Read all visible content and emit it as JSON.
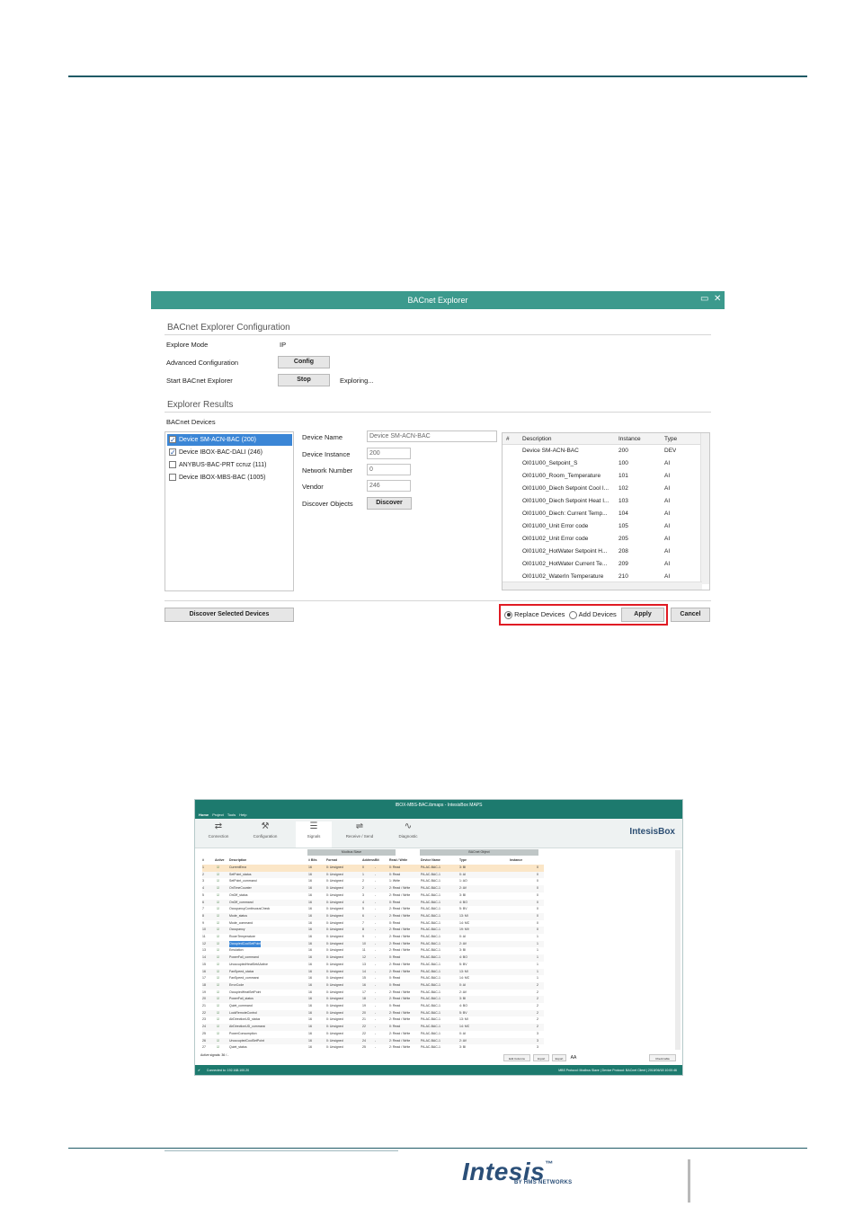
{
  "explorer": {
    "title": "BACnet Explorer",
    "config_title": "BACnet Explorer Configuration",
    "explore_mode_label": "Explore Mode",
    "explore_mode_value": "IP",
    "advanced_label": "Advanced Configuration",
    "config_btn": "Config",
    "start_label": "Start BACnet Explorer",
    "stop_btn": "Stop",
    "status": "Exploring...",
    "results_title": "Explorer Results",
    "devices_label": "BACnet Devices",
    "devices": [
      {
        "label": "Device SM-ACN-BAC (200)",
        "checked": true,
        "selected": true
      },
      {
        "label": "Device IBOX-BAC-DALI (246)",
        "checked": true,
        "selected": false
      },
      {
        "label": "ANYBUS-BAC-PRT ccruz (111)",
        "checked": false,
        "selected": false
      },
      {
        "label": "Device IBOX-MBS-BAC (1005)",
        "checked": false,
        "selected": false
      }
    ],
    "device_name_label": "Device Name",
    "device_name_value": "Device SM-ACN-BAC",
    "device_instance_label": "Device Instance",
    "device_instance_value": "200",
    "network_number_label": "Network Number",
    "network_number_value": "0",
    "vendor_label": "Vendor",
    "vendor_value": "246",
    "discover_objects_label": "Discover Objects",
    "discover_btn": "Discover",
    "objects_headers": {
      "num": "#",
      "description": "Description",
      "instance": "Instance",
      "type": "Type"
    },
    "objects": [
      {
        "checked": false,
        "description": "Device SM-ACN-BAC",
        "instance": "200",
        "type": "DEV"
      },
      {
        "checked": true,
        "description": "OI01U00_Setpoint_S",
        "instance": "100",
        "type": "AI"
      },
      {
        "checked": true,
        "description": "OI01U00_Room_Temperature",
        "instance": "101",
        "type": "AI"
      },
      {
        "checked": false,
        "description": "OI01U00_Diech Setpoint Cool I...",
        "instance": "102",
        "type": "AI"
      },
      {
        "checked": false,
        "description": "OI01U00_Diech Setpoint Heat I...",
        "instance": "103",
        "type": "AI"
      },
      {
        "checked": false,
        "description": "OI01U00_Diech: Current Temp...",
        "instance": "104",
        "type": "AI"
      },
      {
        "checked": true,
        "description": "OI01U00_Unit Error code",
        "instance": "105",
        "type": "AI"
      },
      {
        "checked": false,
        "description": "OI01U02_Unit Error code",
        "instance": "205",
        "type": "AI"
      },
      {
        "checked": false,
        "description": "OI01U02_HotWater Setpoint H...",
        "instance": "208",
        "type": "AI"
      },
      {
        "checked": false,
        "description": "OI01U02_HotWater Current Te...",
        "instance": "209",
        "type": "AI"
      },
      {
        "checked": false,
        "description": "OI01U02_WaterIn Temperature",
        "instance": "210",
        "type": "AI"
      }
    ],
    "discover_selected_btn": "Discover Selected Devices",
    "replace_label": "Replace Devices",
    "add_label": "Add Devices",
    "apply_btn": "Apply",
    "cancel_btn": "Cancel"
  },
  "maps": {
    "title": "IBOX-MBS-BAC.ibmaps - IntesisBox MAPS",
    "menu": [
      "Home",
      "Project",
      "Tools",
      "Help"
    ],
    "tabs": [
      "Connection",
      "Configuration",
      "Signals",
      "Receive / Send",
      "Diagnostic"
    ],
    "brand": "IntesisBox",
    "group_modbus": "Modbus Slave",
    "group_bacnet": "BACnet Object",
    "headers": [
      "#",
      "Active",
      "Description",
      "# Bits",
      "Format",
      "Address",
      "Bit",
      "Read / Write",
      "Device Name",
      "Type",
      "Instance"
    ],
    "rows": [
      [
        "1",
        "CurrentError",
        "16",
        "0: Unsigned",
        "0",
        "-",
        "0: Read",
        "PA-AC-BAC-1",
        "3: BI",
        "0"
      ],
      [
        "2",
        "SetPoint_status",
        "16",
        "0: Unsigned",
        "1",
        "-",
        "0: Read",
        "PA-AC-BAC-1",
        "0: AI",
        "0"
      ],
      [
        "3",
        "SetPoint_command",
        "16",
        "0: Unsigned",
        "2",
        "-",
        "1: Write",
        "PA-AC-BAC-1",
        "1: AO",
        "0"
      ],
      [
        "4",
        "OnTimeCounter",
        "16",
        "0: Unsigned",
        "2",
        "-",
        "2: Read / Write",
        "PA-AC-BAC-1",
        "2: AV",
        "0"
      ],
      [
        "5",
        "OnOff_status",
        "16",
        "0: Unsigned",
        "3",
        "-",
        "2: Read / Write",
        "PA-AC-BAC-1",
        "3: BI",
        "0"
      ],
      [
        "6",
        "OnOff_command",
        "16",
        "0: Unsigned",
        "4",
        "-",
        "0: Read",
        "PA-AC-BAC-1",
        "4: BO",
        "0"
      ],
      [
        "7",
        "OccupancyContinuousCheck",
        "16",
        "0: Unsigned",
        "5",
        "-",
        "2: Read / Write",
        "PA-AC-BAC-1",
        "5: BV",
        "0"
      ],
      [
        "8",
        "Mode_status",
        "16",
        "0: Unsigned",
        "6",
        "-",
        "2: Read / Write",
        "PA-AC-BAC-1",
        "13: MI",
        "0"
      ],
      [
        "9",
        "Mode_command",
        "16",
        "0: Unsigned",
        "7",
        "-",
        "0: Read",
        "PA-AC-BAC-1",
        "14: MO",
        "0"
      ],
      [
        "10",
        "Occupancy",
        "16",
        "0: Unsigned",
        "8",
        "-",
        "2: Read / Write",
        "PA-AC-BAC-1",
        "19: MV",
        "0"
      ],
      [
        "11",
        "RoomTemperature",
        "16",
        "0: Unsigned",
        "9",
        "-",
        "2: Read / Write",
        "PA-AC-BAC-1",
        "0: AI",
        "1"
      ],
      [
        "12",
        "OccupiedCoolSetPoint",
        "16",
        "0: Unsigned",
        "10",
        "-",
        "2: Read / Write",
        "PA-AC-BAC-1",
        "2: AV",
        "1"
      ],
      [
        "13",
        "Emulation",
        "16",
        "0: Unsigned",
        "11",
        "-",
        "2: Read / Write",
        "PA-AC-BAC-1",
        "3: BI",
        "1"
      ],
      [
        "14",
        "PowerFail_command",
        "16",
        "0: Unsigned",
        "12",
        "-",
        "0: Read",
        "PA-AC-BAC-1",
        "4: BO",
        "1"
      ],
      [
        "15",
        "UnoccupiedHeatSetAActive",
        "16",
        "0: Unsigned",
        "13",
        "-",
        "2: Read / Write",
        "PA-AC-BAC-1",
        "5: BV",
        "1"
      ],
      [
        "16",
        "FanSpeed_status",
        "16",
        "0: Unsigned",
        "14",
        "-",
        "2: Read / Write",
        "PA-AC-BAC-1",
        "13: MI",
        "1"
      ],
      [
        "17",
        "FanSpeed_command",
        "16",
        "0: Unsigned",
        "15",
        "-",
        "0: Read",
        "PA-AC-BAC-1",
        "14: MO",
        "1"
      ],
      [
        "18",
        "ErrorCode",
        "16",
        "0: Unsigned",
        "16",
        "-",
        "0: Read",
        "PA-AC-BAC-1",
        "0: AI",
        "2"
      ],
      [
        "19",
        "OccupiedHeatSetPoint",
        "16",
        "0: Unsigned",
        "17",
        "-",
        "2: Read / Write",
        "PA-AC-BAC-1",
        "2: AV",
        "2"
      ],
      [
        "20",
        "PowerFail_status",
        "16",
        "0: Unsigned",
        "18",
        "-",
        "2: Read / Write",
        "PA-AC-BAC-1",
        "3: BI",
        "2"
      ],
      [
        "21",
        "Quiet_command",
        "16",
        "0: Unsigned",
        "19",
        "-",
        "0: Read",
        "PA-AC-BAC-1",
        "4: BO",
        "2"
      ],
      [
        "22",
        "LockRemoteControl",
        "16",
        "0: Unsigned",
        "20",
        "-",
        "2: Read / Write",
        "PA-AC-BAC-1",
        "5: BV",
        "2"
      ],
      [
        "23",
        "AirDirectionUD_status",
        "16",
        "0: Unsigned",
        "21",
        "-",
        "2: Read / Write",
        "PA-AC-BAC-1",
        "13: MI",
        "2"
      ],
      [
        "24",
        "AirDirectionUD_command",
        "16",
        "0: Unsigned",
        "22",
        "-",
        "0: Read",
        "PA-AC-BAC-1",
        "14: MO",
        "2"
      ],
      [
        "25",
        "PowerConsumption",
        "16",
        "0: Unsigned",
        "22",
        "-",
        "2: Read / Write",
        "PA-AC-BAC-1",
        "0: AI",
        "3"
      ],
      [
        "26",
        "UnoccupiedCoolSetPoint",
        "16",
        "0: Unsigned",
        "24",
        "-",
        "2: Read / Write",
        "PA-AC-BAC-1",
        "2: AV",
        "3"
      ],
      [
        "27",
        "Quiet_status",
        "16",
        "0: Unsigned",
        "25",
        "-",
        "2: Read / Write",
        "PA-AC-BAC-1",
        "3: BI",
        "3"
      ]
    ],
    "active_signals": "Active signals: 36 / -",
    "footer_buttons": [
      "Edit Columns",
      "Import",
      "Export",
      "AA",
      "Check table"
    ],
    "status_left": "Connected to: 192.168.100.20",
    "status_right": "MBS Protocol: Modbus Slave  |  Device Protocol: BACnet Client  |  2018/06/18 10:00:46"
  },
  "logo": {
    "text": "Intesis",
    "tm": "™",
    "sub": "BY HMS NETWORKS"
  }
}
